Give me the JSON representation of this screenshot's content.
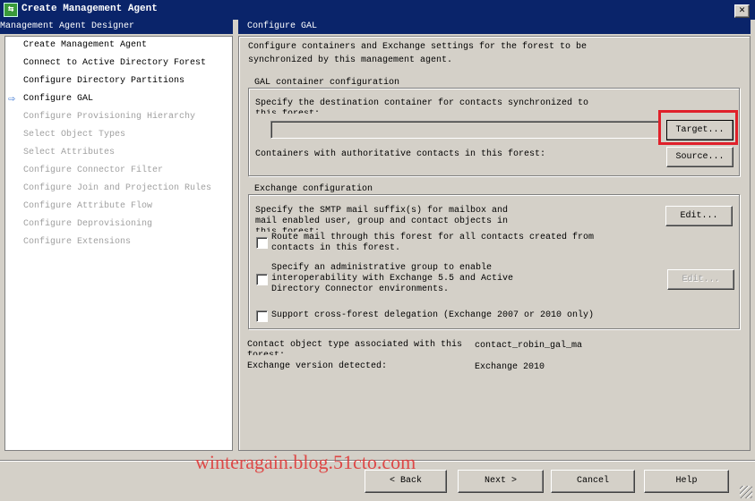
{
  "window": {
    "title": "Create Management Agent",
    "close_icon": "close-icon",
    "app_icon": "management-agent-icon"
  },
  "left": {
    "header": "Management Agent Designer",
    "current_icon": "arrow-right-icon",
    "items": [
      {
        "label": "Create Management Agent",
        "state": "done"
      },
      {
        "label": "Connect to Active Directory Forest",
        "state": "done"
      },
      {
        "label": "Configure Directory Partitions",
        "state": "done"
      },
      {
        "label": "Configure GAL",
        "state": "current"
      },
      {
        "label": "Configure Provisioning Hierarchy",
        "state": "disabled"
      },
      {
        "label": "Select Object Types",
        "state": "disabled"
      },
      {
        "label": "Select Attributes",
        "state": "disabled"
      },
      {
        "label": "Configure Connector Filter",
        "state": "disabled"
      },
      {
        "label": "Configure Join and Projection Rules",
        "state": "disabled"
      },
      {
        "label": "Configure Attribute Flow",
        "state": "disabled"
      },
      {
        "label": "Configure Deprovisioning",
        "state": "disabled"
      },
      {
        "label": "Configure Extensions",
        "state": "disabled"
      }
    ]
  },
  "main": {
    "header": "Configure GAL",
    "desc1": "Configure containers and Exchange settings for the forest to be",
    "desc2": "synchronized by this management agent.",
    "gal": {
      "label": "GAL container configuration",
      "dest1": "Specify the destination container for contacts synchronized to",
      "dest2": "this forest:",
      "target_value": "",
      "target_button": "Target...",
      "containers_label": "Containers with authoritative contacts in this forest:",
      "source_button": "Source..."
    },
    "exchange": {
      "label": "Exchange configuration",
      "smtp1": "Specify the SMTP mail suffix(s) for mailbox and",
      "smtp2": "mail enabled user, group and contact objects in",
      "smtp3": "this forest:",
      "edit_button": "Edit...",
      "route1": "Route mail through this forest for all contacts created from",
      "route2": "contacts in this forest.",
      "route_checked": false,
      "admin1": "Specify an administrative group to enable",
      "admin2": "interoperability with Exchange 5.5 and Active",
      "admin3": "Directory Connector environments.",
      "admin_checked": false,
      "admin_edit_button": "Edit...",
      "cross1": "Support cross-forest delegation (Exchange 2007 or 2010 only)",
      "cross_checked": false
    },
    "contact_label1": "Contact object type associated with this",
    "contact_label2": "forest:",
    "contact_value": "contact_robin_gal_ma",
    "version_label": "Exchange version detected:",
    "version_value": "Exchange 2010"
  },
  "footer": {
    "back": "< Back",
    "next": "Next >",
    "cancel": "Cancel",
    "help": "Help"
  },
  "watermark": "winteragain.blog.51cto.com",
  "colors": {
    "titlebar": "#0a246a",
    "highlight": "#e0202a",
    "watermark": "#e03030"
  }
}
